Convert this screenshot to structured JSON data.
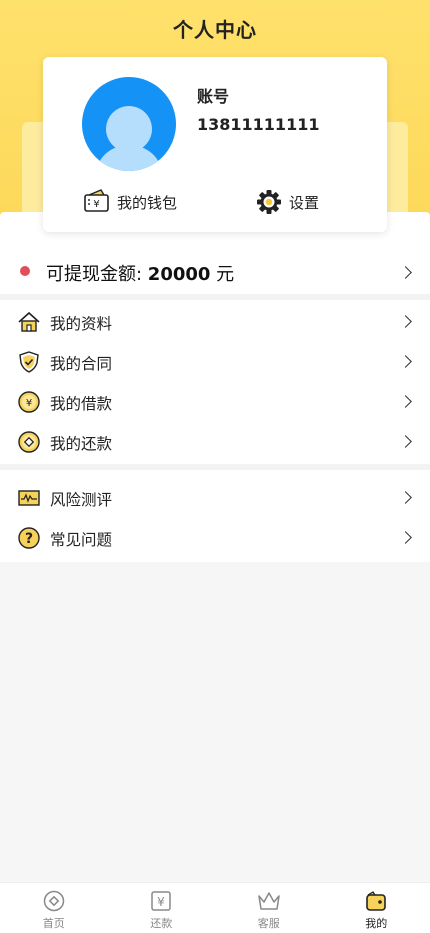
{
  "header": {
    "title": "个人中心"
  },
  "profile": {
    "account_label": "账号",
    "phone": "13811111111",
    "wallet_label": "我的钱包",
    "settings_label": "设置"
  },
  "balance": {
    "prefix": "可提现金额: ",
    "amount": "20000",
    "unit": " 元"
  },
  "menu_group1": [
    {
      "label": "我的资料",
      "icon": "home-icon"
    },
    {
      "label": "我的合同",
      "icon": "shield-check-icon"
    },
    {
      "label": "我的借款",
      "icon": "yen-coin-icon"
    },
    {
      "label": "我的还款",
      "icon": "coin-icon"
    }
  ],
  "menu_group2": [
    {
      "label": "风险测评",
      "icon": "chart-card-icon"
    },
    {
      "label": "常见问题",
      "icon": "question-icon"
    }
  ],
  "tabs": [
    {
      "label": "首页",
      "icon": "home-circle-icon",
      "active": false
    },
    {
      "label": "还款",
      "icon": "yen-box-icon",
      "active": false
    },
    {
      "label": "客服",
      "icon": "crown-icon",
      "active": false
    },
    {
      "label": "我的",
      "icon": "user-wallet-icon",
      "active": true
    }
  ],
  "colors": {
    "accent": "#fdd95a",
    "avatar": "#1592f6",
    "dot": "#e24d5a"
  }
}
